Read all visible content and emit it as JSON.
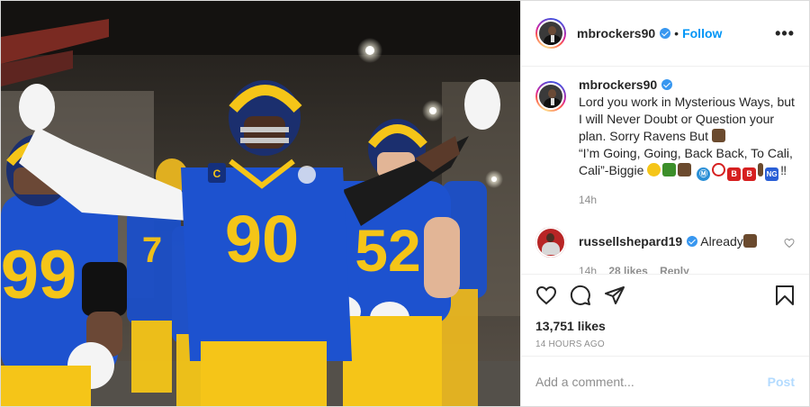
{
  "post": {
    "author": {
      "username": "mbrockers90",
      "verified": true,
      "follow_label": "Follow",
      "more_icon": "ellipsis-icon"
    },
    "photo": {
      "jersey_numbers": [
        "90",
        "52",
        "99",
        "7",
        "9"
      ],
      "captain_patch": "C"
    },
    "caption": {
      "username": "mbrockers90",
      "text": "Lord you work in Mysterious Ways, but I will Never Doubt or Question your plan. Sorry Ravens But",
      "quote": "“I’m Going, Going, Back Back, To Cali, Cali”-Biggie",
      "emoji_badges": [
        "Ⓜ",
        "B",
        "B",
        "NG"
      ],
      "emoji_tail": "‼",
      "time": "14h"
    },
    "comments": [
      {
        "username": "russellshepard19",
        "verified": true,
        "text": "Already",
        "time": "14h",
        "likes": "28 likes",
        "reply_label": "Reply"
      }
    ],
    "likes": "13,751 likes",
    "time_ago": "14 HOURS AGO",
    "add_comment": {
      "placeholder": "Add a comment...",
      "post_label": "Post"
    },
    "colors": {
      "accent": "#0095f6",
      "post_disabled": "#b3dbff",
      "meta": "#8e8e8e",
      "rams_blue": "#1b4fc9",
      "rams_gold": "#f5c518"
    }
  }
}
